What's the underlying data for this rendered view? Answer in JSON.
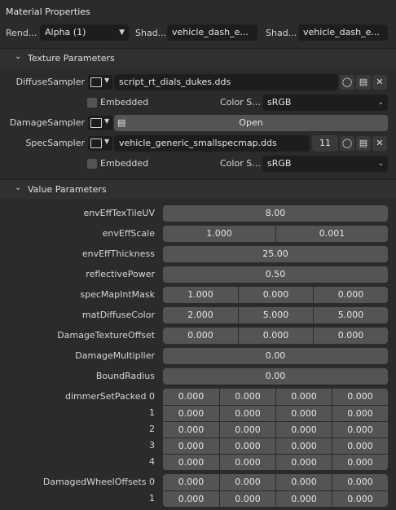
{
  "header": {
    "title": "Material Properties",
    "render_label": "Rend...",
    "render_value": "Alpha (1)",
    "shader1_label": "Shad...",
    "shader1_value": "vehicle_dash_e...",
    "shader2_label": "Shad...",
    "shader2_value": "vehicle_dash_e..."
  },
  "texture_params": {
    "title": "Texture Parameters",
    "diffuse": {
      "label": "DiffuseSampler",
      "file": "script_rt_dials_dukes.dds"
    },
    "diffuse_embedded": {
      "label": "Embedded",
      "colorspace_label": "Color S...",
      "colorspace_value": "sRGB"
    },
    "damage": {
      "label": "DamageSampler",
      "open_label": "Open"
    },
    "spec": {
      "label": "SpecSampler",
      "file": "vehicle_generic_smallspecmap.dds",
      "users": "11"
    },
    "spec_embedded": {
      "label": "Embedded",
      "colorspace_label": "Color S...",
      "colorspace_value": "sRGB"
    }
  },
  "value_params": {
    "title": "Value Parameters",
    "envEffTexTileUV": {
      "label": "envEffTexTileUV",
      "value": "8.00"
    },
    "envEffScale": {
      "label": "envEffScale",
      "values": [
        "1.000",
        "0.001"
      ]
    },
    "envEffThickness": {
      "label": "envEffThickness",
      "value": "25.00"
    },
    "reflectivePower": {
      "label": "reflectivePower",
      "value": "0.50"
    },
    "specMapIntMask": {
      "label": "specMapIntMask",
      "values": [
        "1.000",
        "0.000",
        "0.000"
      ]
    },
    "matDiffuseColor": {
      "label": "matDiffuseColor",
      "values": [
        "2.000",
        "5.000",
        "5.000"
      ]
    },
    "DamageTextureOffset": {
      "label": "DamageTextureOffset",
      "values": [
        "0.000",
        "0.000",
        "0.000"
      ]
    },
    "DamageMultiplier": {
      "label": "DamageMultiplier",
      "value": "0.00"
    },
    "BoundRadius": {
      "label": "BoundRadius",
      "value": "0.00"
    },
    "dimmerSetPacked": {
      "label": "dimmerSetPacked 0",
      "row_labels": [
        "",
        "1",
        "2",
        "3",
        "4"
      ],
      "rows": [
        [
          "0.000",
          "0.000",
          "0.000",
          "0.000"
        ],
        [
          "0.000",
          "0.000",
          "0.000",
          "0.000"
        ],
        [
          "0.000",
          "0.000",
          "0.000",
          "0.000"
        ],
        [
          "0.000",
          "0.000",
          "0.000",
          "0.000"
        ],
        [
          "0.000",
          "0.000",
          "0.000",
          "0.000"
        ]
      ]
    },
    "DamagedWheelOffsets": {
      "label": "DamagedWheelOffsets 0",
      "row_labels": [
        "",
        "1"
      ],
      "rows": [
        [
          "0.000",
          "0.000",
          "0.000",
          "0.000"
        ],
        [
          "0.000",
          "0.000",
          "0.000",
          "0.000"
        ]
      ]
    }
  }
}
